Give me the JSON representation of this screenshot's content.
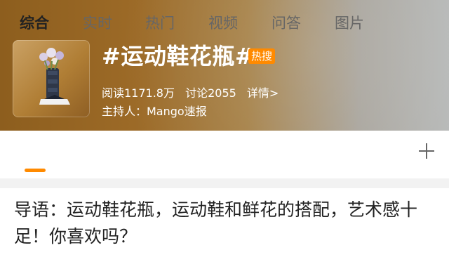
{
  "topic": {
    "title": "#运动鞋花瓶#",
    "badge": "热搜",
    "stats": {
      "reads": "阅读1171.8万",
      "discussions": "讨论2055",
      "details": "详情>"
    },
    "host": "主持人：Mango速报"
  },
  "tabs": [
    "综合",
    "实时",
    "热门",
    "视频",
    "问答",
    "图片"
  ],
  "accent_color": "#ff8a00",
  "intro": "导语：运动鞋花瓶，运动鞋和鲜花的搭配，艺术感十足！你喜欢吗？"
}
